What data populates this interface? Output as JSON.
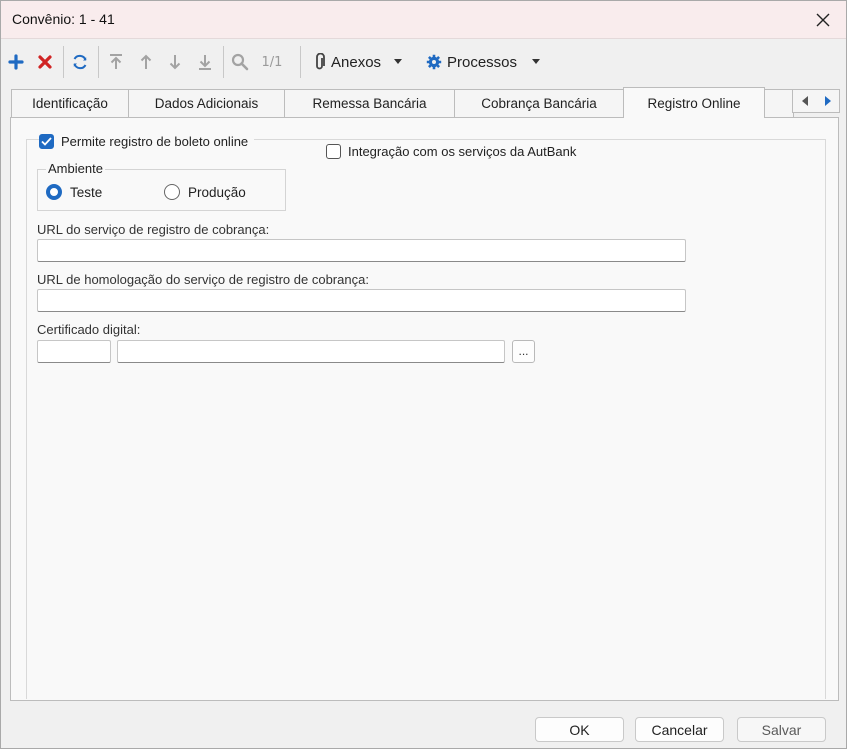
{
  "window": {
    "title": "Convênio: 1 - 41"
  },
  "toolbar": {
    "count": "1/1",
    "anexos_label": "Anexos",
    "processos_label": "Processos"
  },
  "tabs": [
    {
      "label": "Identificação"
    },
    {
      "label": "Dados Adicionais"
    },
    {
      "label": "Remessa Bancária"
    },
    {
      "label": "Cobrança Bancária"
    },
    {
      "label": "Registro Online"
    }
  ],
  "registro_online": {
    "permite_registro_label": "Permite registro de boleto online",
    "permite_registro_checked": true,
    "autbank_label": "Integração com os serviços da AutBank",
    "autbank_checked": false,
    "ambiente": {
      "legend": "Ambiente",
      "options": [
        {
          "label": "Teste",
          "selected": true
        },
        {
          "label": "Produção",
          "selected": false
        }
      ]
    },
    "url_registro_label": "URL do serviço de registro de cobrança:",
    "url_registro_value": "",
    "url_homologacao_label": "URL de homologação do serviço de registro de cobrança:",
    "url_homologacao_value": "",
    "certificado_label": "Certificado digital:",
    "certificado_code": "",
    "certificado_name": "",
    "browse_label": "..."
  },
  "footer": {
    "ok_label": "OK",
    "cancel_label": "Cancelar",
    "save_label": "Salvar"
  },
  "colors": {
    "accent": "#1f6ac2",
    "add_icon": "#1f6ac2",
    "delete_icon": "#d02424",
    "titlebar_bg": "#f9eced"
  }
}
